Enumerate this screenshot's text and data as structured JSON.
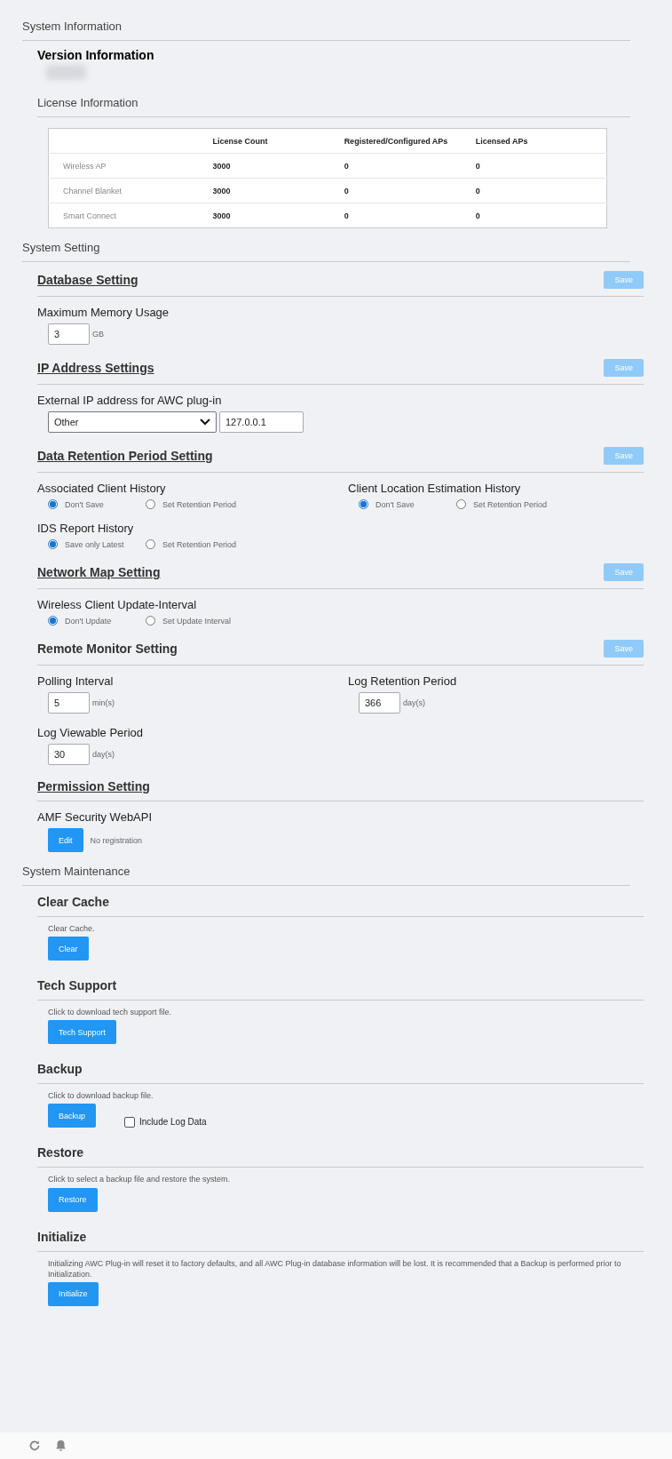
{
  "system_information": {
    "title": "System Information",
    "version": {
      "title": "Version Information"
    },
    "license": {
      "title": "License Information",
      "columns": [
        "License Count",
        "Registered/Configured APs",
        "Licensed APs"
      ],
      "rows": [
        {
          "name": "Wireless AP",
          "values": [
            "3000",
            "0",
            "0"
          ]
        },
        {
          "name": "Channel Blanket",
          "values": [
            "3000",
            "0",
            "0"
          ]
        },
        {
          "name": "Smart Connect",
          "values": [
            "3000",
            "0",
            "0"
          ]
        }
      ]
    }
  },
  "system_setting": {
    "title": "System Setting",
    "sections": [
      {
        "title": "Database Setting",
        "underlined": true,
        "save": {
          "label": "Save",
          "disabled": true
        },
        "rows": [
          [
            {
              "kind": "input",
              "label": "Maximum Memory Usage",
              "value": "3",
              "unit": "GB"
            }
          ]
        ]
      },
      {
        "title": "IP Address Settings",
        "underlined": true,
        "save": {
          "label": "Save",
          "disabled": true
        },
        "rows": [
          [
            {
              "kind": "select",
              "label": "External IP address for AWC plug-in",
              "value": "Other",
              "input": "127.0.0.1"
            }
          ]
        ]
      },
      {
        "title": "Data Retention Period Setting",
        "underlined": true,
        "save": {
          "label": "Save",
          "disabled": true
        },
        "rows": [
          [
            {
              "kind": "radio",
              "label": "Associated Client History",
              "options": [
                {
                  "label": "Don't Save",
                  "selected": true
                },
                {
                  "label": "Set Retention Period",
                  "selected": false
                }
              ]
            },
            {
              "kind": "radio",
              "label": "Client Location Estimation History",
              "options": [
                {
                  "label": "Don't Save",
                  "selected": true
                },
                {
                  "label": "Set Retention Period",
                  "selected": false
                }
              ]
            }
          ],
          [
            {
              "kind": "radio",
              "label": "IDS Report History",
              "options": [
                {
                  "label": "Save only Latest",
                  "selected": true
                },
                {
                  "label": "Set Retention Period",
                  "selected": false
                }
              ]
            }
          ]
        ]
      },
      {
        "title": "Network Map Setting",
        "underlined": true,
        "save": {
          "label": "Save",
          "disabled": true
        },
        "rows": [
          [
            {
              "kind": "radio",
              "label": "Wireless Client Update-Interval",
              "options": [
                {
                  "label": "Don't Update",
                  "selected": true
                },
                {
                  "label": "Set Update Interval",
                  "selected": false
                }
              ]
            }
          ]
        ]
      },
      {
        "title": "Remote Monitor Setting",
        "underlined": false,
        "save": {
          "label": "Save",
          "disabled": true
        },
        "rows": [
          [
            {
              "kind": "input",
              "label": "Polling Interval",
              "value": "5",
              "unit": "min(s)"
            },
            {
              "kind": "input",
              "label": "Log Retention Period",
              "value": "366",
              "unit": "day(s)"
            }
          ],
          [
            {
              "kind": "input",
              "label": "Log Viewable Period",
              "value": "30",
              "unit": "day(s)"
            }
          ]
        ]
      },
      {
        "title": "Permission Setting",
        "underlined": true,
        "rows": [
          [
            {
              "kind": "button",
              "label": "AMF Security WebAPI",
              "button": "Edit",
              "note": "No registration"
            }
          ]
        ]
      }
    ]
  },
  "system_maintenance": {
    "title": "System Maintenance",
    "items": [
      {
        "title": "Clear Cache",
        "description": "Clear Cache.",
        "button": "Clear"
      },
      {
        "title": "Tech Support",
        "description": "Click to download tech support file.",
        "button": "Tech Support"
      },
      {
        "title": "Backup",
        "description": "Click to download backup file.",
        "button": "Backup",
        "checkbox": {
          "label": "Include Log Data",
          "checked": false
        }
      },
      {
        "title": "Restore",
        "description": "Click to select a backup file and restore the system.",
        "button": "Restore"
      },
      {
        "title": "Initialize",
        "description": "Initializing AWC Plug-in will reset it to factory defaults, and all AWC Plug-in database information will be lost. It is recommended that a Backup is performed prior to Initialization.",
        "button": "Initialize"
      }
    ]
  }
}
